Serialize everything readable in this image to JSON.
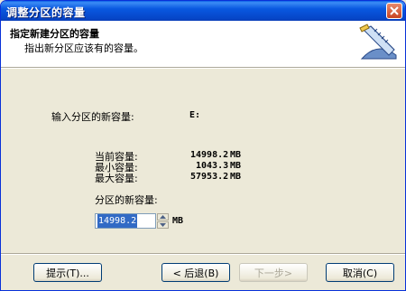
{
  "window": {
    "title": "调整分区的容量"
  },
  "header": {
    "title": "指定新建分区的容量",
    "subtitle": "指出新分区应该有的容量。"
  },
  "body": {
    "prompt_label": "输入分区的新容量:",
    "drive_letter": "E:",
    "current_label": "当前容量:",
    "current_value": "14998.2",
    "min_label": "最小容量:",
    "min_value": "1043.3",
    "max_label": "最大容量:",
    "max_value": "57953.2",
    "unit": "MB",
    "new_size_label": "分区的新容量:",
    "new_size_value": "14998.2",
    "new_size_unit": "MB"
  },
  "buttons": {
    "hint": "提示(T)...",
    "back": "< 后退(B)",
    "next": "下一步>",
    "cancel": "取消(C)"
  },
  "icons": {
    "close": "close-icon",
    "wizard": "ruler-triangle-icon",
    "spin_up": "arrow-up-icon",
    "spin_down": "arrow-down-icon"
  }
}
